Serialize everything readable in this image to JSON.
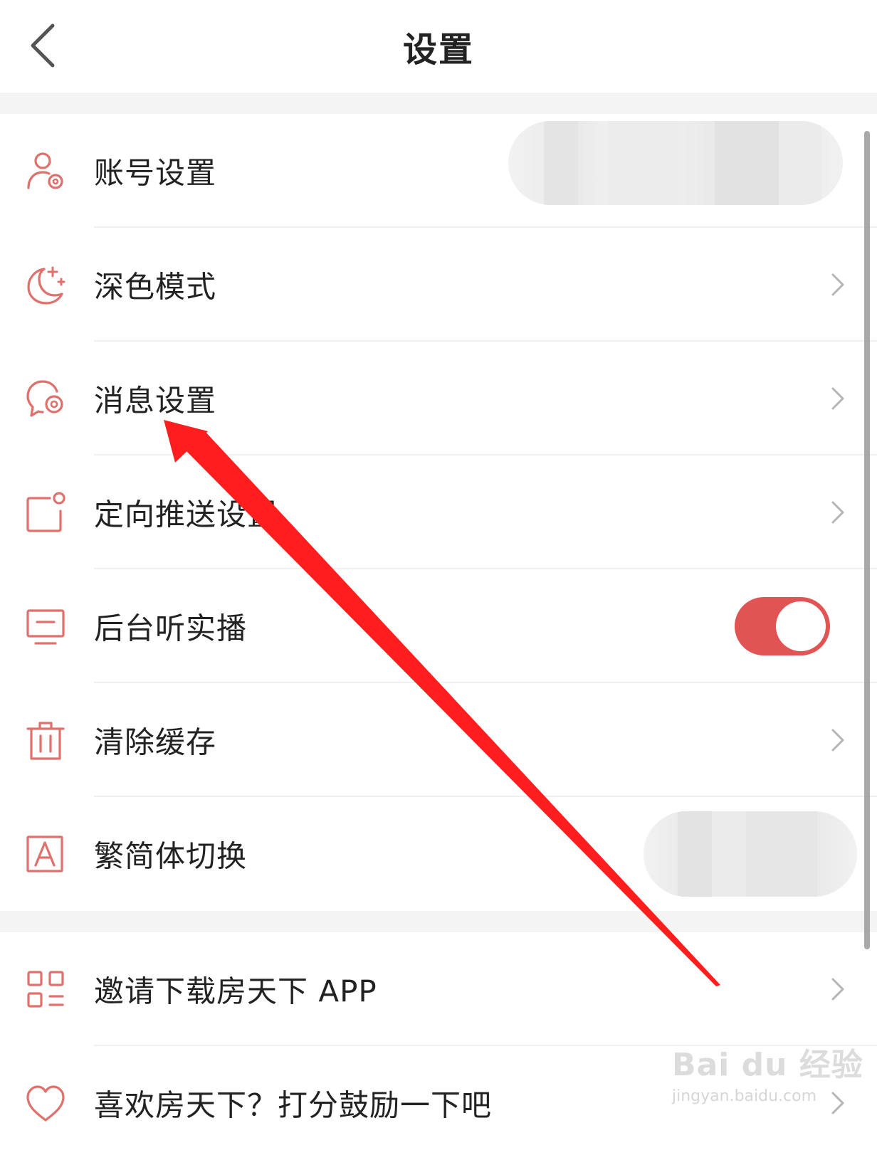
{
  "header": {
    "title": "设置",
    "back_icon": "chevron-left-icon"
  },
  "settings": {
    "account": {
      "label": "账号设置",
      "icon": "user-gear-icon"
    },
    "dark_mode": {
      "label": "深色模式",
      "icon": "moon-stars-icon"
    },
    "message": {
      "label": "消息设置",
      "icon": "chat-gear-icon"
    },
    "targeted_push": {
      "label": "定向推送设置",
      "icon": "notification-square-icon"
    },
    "background_listen": {
      "label": "后台听实播",
      "icon": "monitor-icon",
      "toggle_on": true
    },
    "clear_cache": {
      "label": "清除缓存",
      "icon": "trash-icon"
    },
    "traditional_simplified": {
      "label": "繁简体切换",
      "icon": "letter-a-icon"
    }
  },
  "more": {
    "invite": {
      "label": "邀请下载房天下 APP",
      "icon": "qr-code-icon"
    },
    "rate": {
      "label": "喜欢房天下？打分鼓励一下吧",
      "icon": "heart-icon"
    }
  },
  "colors": {
    "accent": "#e05553",
    "icon": "#e0706c",
    "annotation_arrow": "#ff1e1e"
  },
  "watermark": {
    "main": "Bai du 经验",
    "sub": "jingyan.baidu.com"
  }
}
